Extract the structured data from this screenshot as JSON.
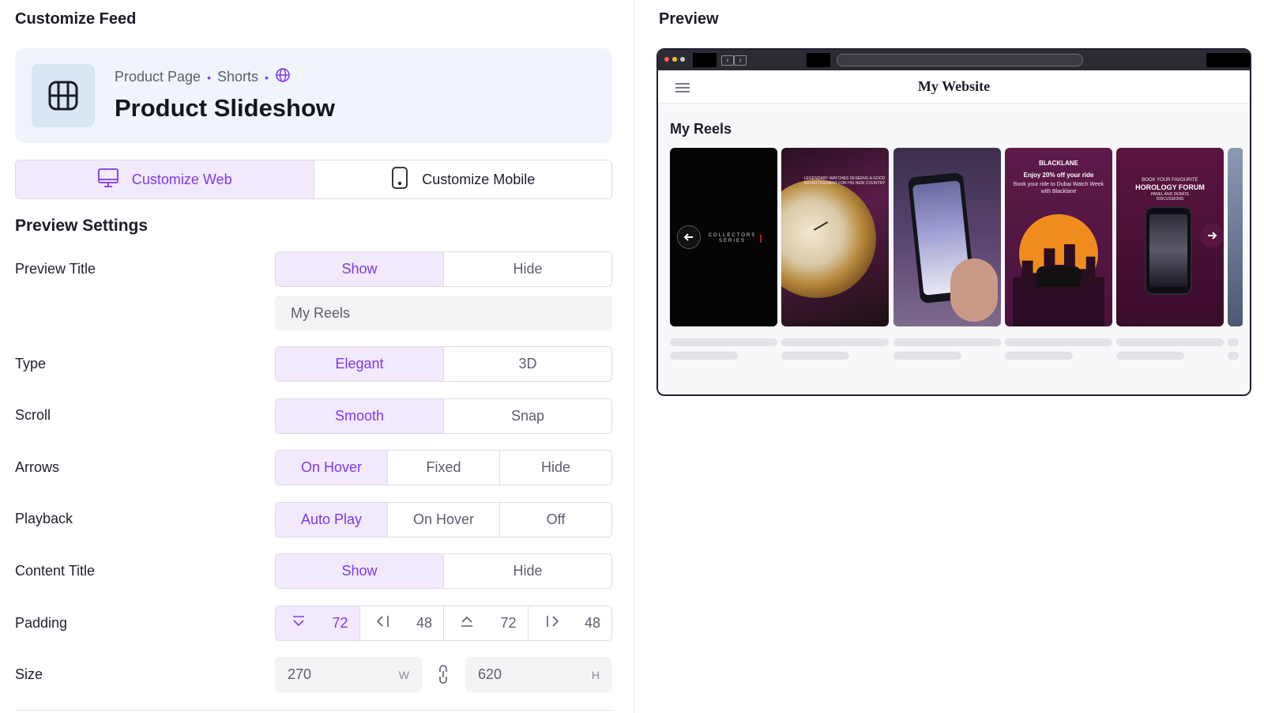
{
  "left_title": "Customize Feed",
  "right_title": "Preview",
  "header": {
    "breadcrumb": [
      "Product Page",
      "Shorts"
    ],
    "title": "Product Slideshow",
    "icon": "grid-layout-icon"
  },
  "tabs": [
    {
      "label": "Customize Web",
      "icon": "monitor-icon",
      "active": true
    },
    {
      "label": "Customize Mobile",
      "icon": "phone-icon",
      "active": false
    }
  ],
  "preview_settings": {
    "heading": "Preview Settings",
    "preview_title": {
      "label": "Preview Title",
      "options": [
        "Show",
        "Hide"
      ],
      "selected": "Show",
      "input_value": "My Reels"
    },
    "type": {
      "label": "Type",
      "options": [
        "Elegant",
        "3D"
      ],
      "selected": "Elegant"
    },
    "scroll": {
      "label": "Scroll",
      "options": [
        "Smooth",
        "Snap"
      ],
      "selected": "Smooth"
    },
    "arrows": {
      "label": "Arrows",
      "options": [
        "On Hover",
        "Fixed",
        "Hide"
      ],
      "selected": "On Hover"
    },
    "playback": {
      "label": "Playback",
      "options": [
        "Auto Play",
        "On Hover",
        "Off"
      ],
      "selected": "Auto Play"
    },
    "content_title": {
      "label": "Content Title",
      "options": [
        "Show",
        "Hide"
      ],
      "selected": "Show"
    },
    "padding": {
      "label": "Padding",
      "bottom": "72",
      "left": "48",
      "top": "72",
      "right": "48"
    },
    "size": {
      "label": "Size",
      "width": "270",
      "width_unit": "W",
      "height": "620",
      "height_unit": "H"
    }
  },
  "preview": {
    "site_title": "My Website",
    "reels_title": "My Reels",
    "reels": [
      {
        "caption": "COLLECTORS SERIES"
      },
      {
        "caption": "LEGENDARY WATCHES DESERVE A GOOD ADVERTISEMENT FOR HIS NEW COUNTRY"
      },
      {
        "caption": ""
      },
      {
        "caption_top": "BLACKLANE",
        "caption_main": "Enjoy 20% off your ride",
        "caption_sub": "Book your ride to Dubai Watch Week with Blacklane"
      },
      {
        "caption_top": "BOOK YOUR FAVOURITE",
        "caption_main": "HOROLOGY FORUM",
        "caption_sub": "PANEL AND DEBATE DISCUSSIONS"
      }
    ]
  },
  "colors": {
    "accent": "#7c3aed",
    "active_bg": "#f2e9fc",
    "header_card": "#f0f4fb"
  }
}
